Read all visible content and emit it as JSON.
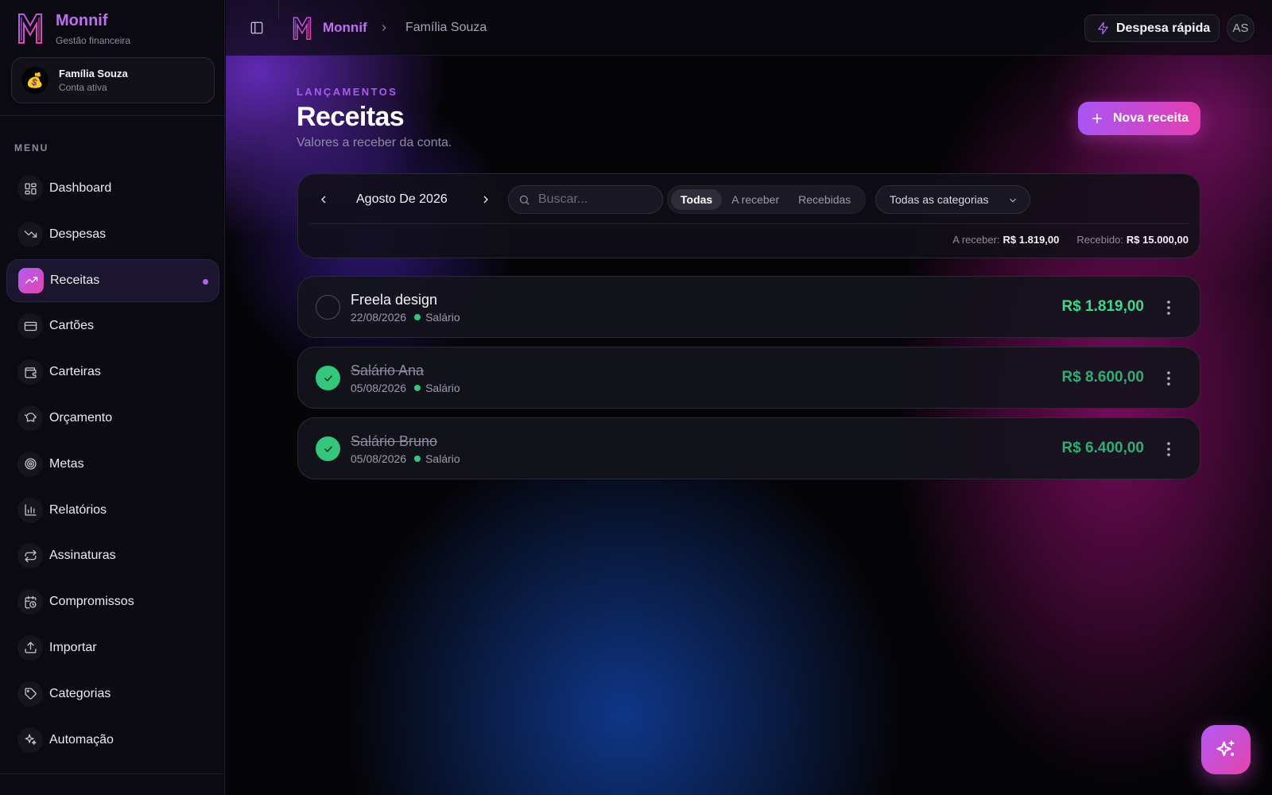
{
  "brand": {
    "name": "Monnif",
    "subtitle": "Gestão financeira",
    "accent": "#c06ef5"
  },
  "account": {
    "avatar": "💰",
    "name": "Família Souza",
    "status": "Conta ativa"
  },
  "sidebar": {
    "menu_label": "MENU",
    "items": [
      {
        "label": "Dashboard",
        "icon": "grid-icon"
      },
      {
        "label": "Despesas",
        "icon": "trending-down-icon"
      },
      {
        "label": "Receitas",
        "icon": "trending-up-icon",
        "active": true
      },
      {
        "label": "Cartões",
        "icon": "credit-card-icon"
      },
      {
        "label": "Carteiras",
        "icon": "wallet-icon"
      },
      {
        "label": "Orçamento",
        "icon": "piggy-bank-icon"
      },
      {
        "label": "Metas",
        "icon": "target-icon"
      },
      {
        "label": "Relatórios",
        "icon": "bar-chart-icon"
      },
      {
        "label": "Assinaturas",
        "icon": "repeat-icon"
      },
      {
        "label": "Compromissos",
        "icon": "calendar-clock-icon"
      },
      {
        "label": "Importar",
        "icon": "upload-icon"
      },
      {
        "label": "Categorias",
        "icon": "tag-icon"
      },
      {
        "label": "Automação",
        "icon": "sparkles-icon"
      }
    ]
  },
  "topbar": {
    "breadcrumb_brand": "Monnif",
    "breadcrumb_current": "Família Souza",
    "quick_expense_label": "Despesa rápida",
    "user_initials": "AS"
  },
  "header": {
    "eyebrow": "LANÇAMENTOS",
    "title": "Receitas",
    "subtitle": "Valores a receber da conta.",
    "new_button_label": "Nova receita"
  },
  "filters": {
    "month_label": "Agosto De 2026",
    "search_placeholder": "Buscar...",
    "status_options": [
      "Todas",
      "A receber",
      "Recebidas"
    ],
    "status_selected": "Todas",
    "category_selected": "Todas as categorias",
    "totals": {
      "to_receive_label": "A receber:",
      "to_receive_value": "R$ 1.819,00",
      "received_label": "Recebido:",
      "received_value": "R$ 15.000,00"
    }
  },
  "entries": [
    {
      "title": "Freela design",
      "date": "22/08/2026",
      "category": "Salário",
      "amount": "R$ 1.819,00",
      "received": false
    },
    {
      "title": "Salário Ana",
      "date": "05/08/2026",
      "category": "Salário",
      "amount": "R$ 8.600,00",
      "received": true
    },
    {
      "title": "Salário Bruno",
      "date": "05/08/2026",
      "category": "Salário",
      "amount": "R$ 6.400,00",
      "received": true
    }
  ],
  "colors": {
    "income_green": "#3ed88a",
    "gradient_start": "#a955f5",
    "gradient_end": "#e43fb0"
  },
  "fab": {
    "icon": "ai-sparkles-icon"
  }
}
